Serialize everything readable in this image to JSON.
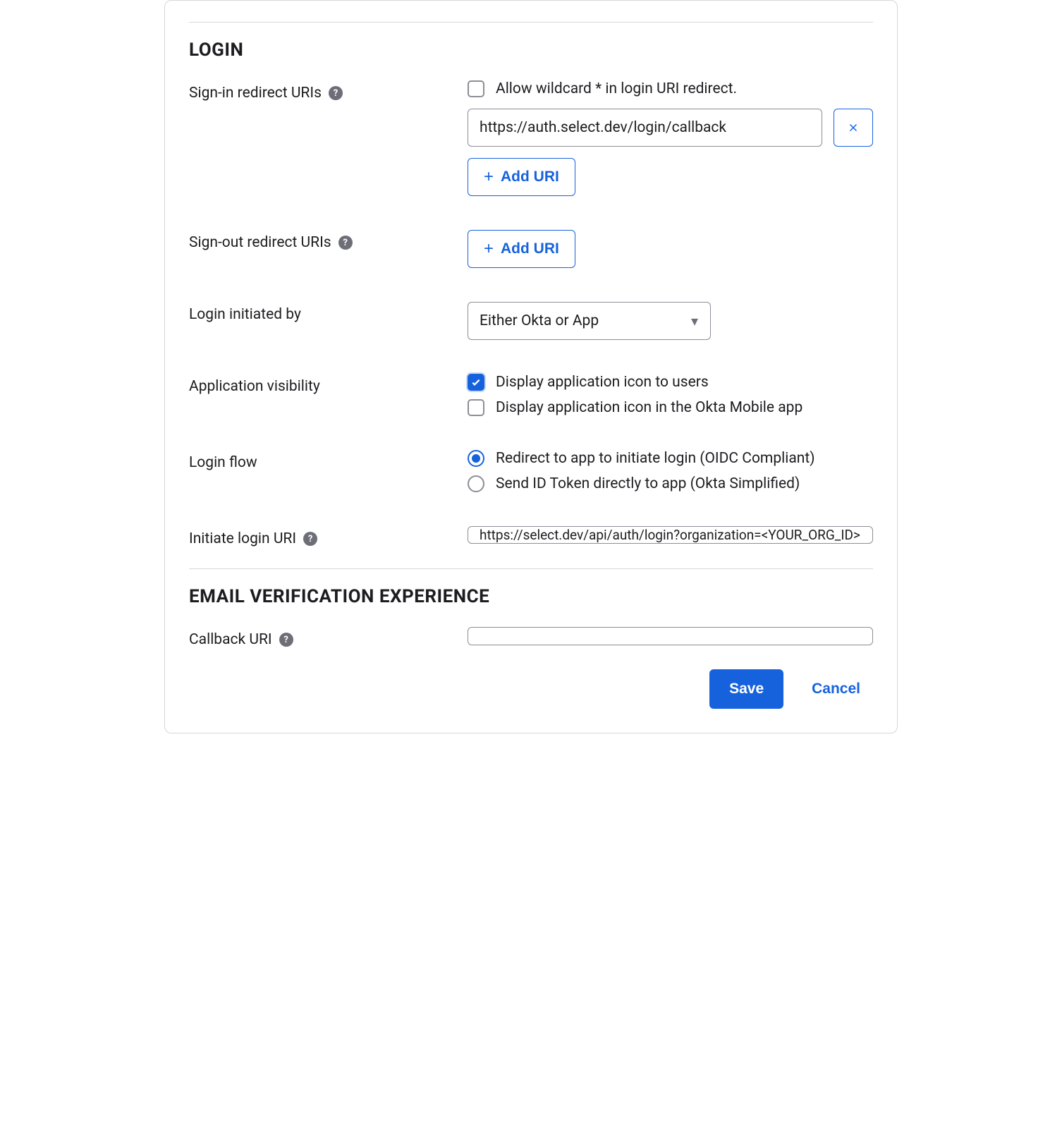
{
  "login": {
    "section_title": "LOGIN",
    "sign_in_label": "Sign-in redirect URIs",
    "allow_wildcard_label": "Allow wildcard * in login URI redirect.",
    "allow_wildcard_checked": false,
    "sign_in_uris": [
      "https://auth.select.dev/login/callback"
    ],
    "add_uri_label": "Add URI",
    "sign_out_label": "Sign-out redirect URIs",
    "login_initiated_label": "Login initiated by",
    "login_initiated_value": "Either Okta or App",
    "app_visibility_label": "Application visibility",
    "app_visibility": {
      "display_users": {
        "label": "Display application icon to users",
        "checked": true
      },
      "display_mobile": {
        "label": "Display application icon in the Okta Mobile app",
        "checked": false
      }
    },
    "login_flow_label": "Login flow",
    "login_flow": {
      "redirect": {
        "label": "Redirect to app to initiate login (OIDC Compliant)",
        "selected": true
      },
      "send_token": {
        "label": "Send ID Token directly to app (Okta Simplified)",
        "selected": false
      }
    },
    "initiate_login_label": "Initiate login URI",
    "initiate_login_value": "https://select.dev/api/auth/login?organization=<YOUR_ORG_ID>"
  },
  "email_verification": {
    "section_title": "EMAIL VERIFICATION EXPERIENCE",
    "callback_label": "Callback URI",
    "callback_value": ""
  },
  "footer": {
    "save_label": "Save",
    "cancel_label": "Cancel"
  }
}
